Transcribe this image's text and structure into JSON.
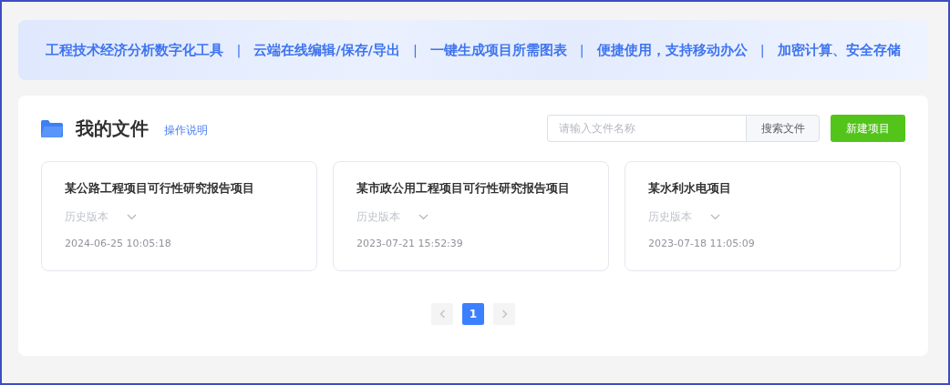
{
  "banner": {
    "items": [
      {
        "kind": "feature",
        "text": "工程技术经济分析数字化工具"
      },
      {
        "kind": "separator",
        "text": "|"
      },
      {
        "kind": "feature",
        "text": "云端在线编辑/保存/导出"
      },
      {
        "kind": "separator",
        "text": "|"
      },
      {
        "kind": "feature",
        "text": "一键生成项目所需图表"
      },
      {
        "kind": "separator",
        "text": "|"
      },
      {
        "kind": "feature",
        "text": "便捷使用，支持移动办公"
      },
      {
        "kind": "separator",
        "text": "|"
      },
      {
        "kind": "feature",
        "text": "加密计算、安全存储"
      }
    ]
  },
  "header": {
    "title": "我的文件",
    "help_link": "操作说明",
    "search": {
      "placeholder": "请输入文件名称",
      "button": "搜索文件"
    },
    "new_button": "新建项目"
  },
  "files": [
    {
      "name": "某公路工程项目可行性研究报告项目",
      "versions": "历史版本",
      "time": "2024-06-25 10:05:18"
    },
    {
      "name": "某市政公用工程项目可行性研究报告项目",
      "versions": "历史版本",
      "time": "2023-07-21 15:52:39"
    },
    {
      "name": "某水利水电项目",
      "versions": "历史版本",
      "time": "2023-07-18 11:05:09"
    }
  ],
  "pagination": {
    "prev_disabled": true,
    "next_disabled": true,
    "pages": [
      {
        "label": "1",
        "selected": true
      }
    ]
  }
}
